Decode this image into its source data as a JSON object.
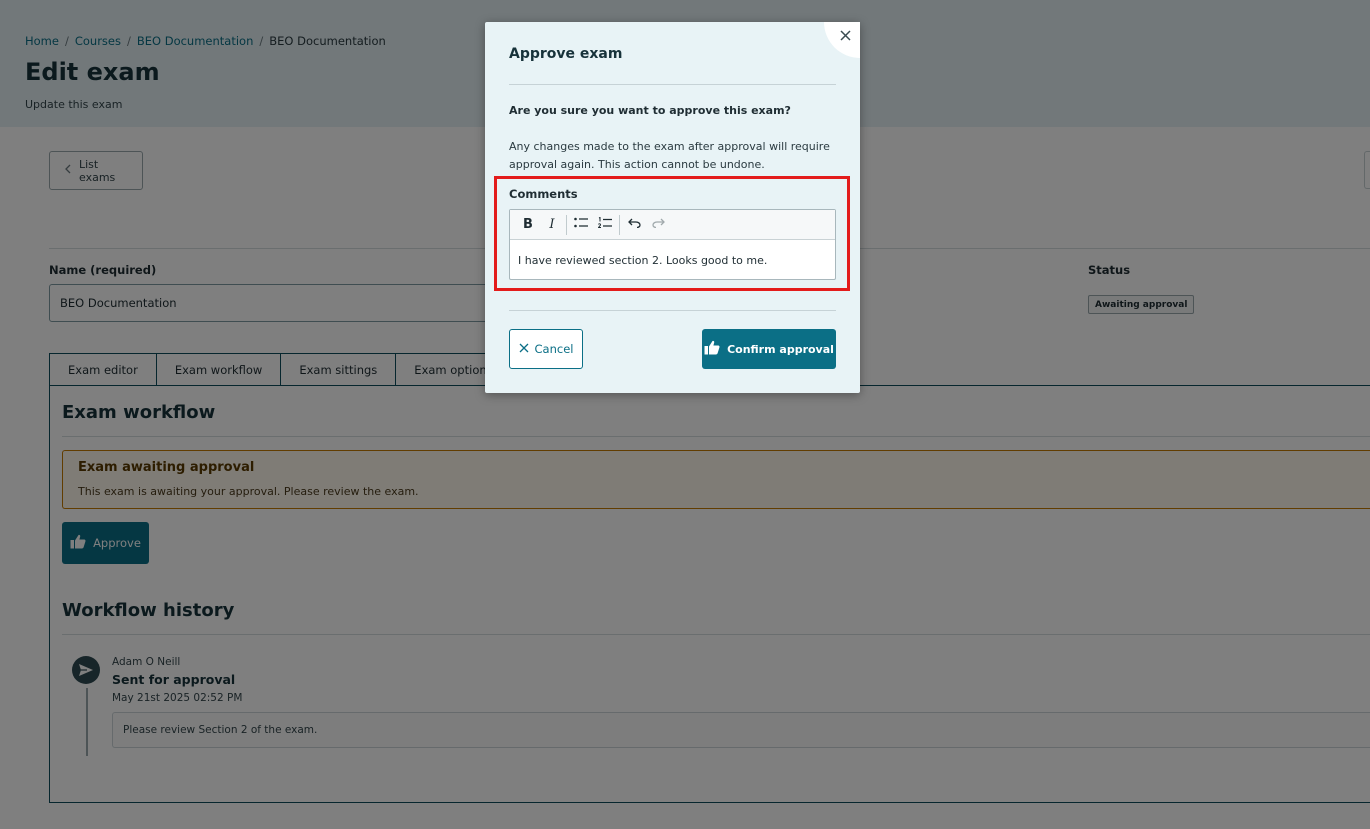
{
  "breadcrumb": {
    "items": [
      "Home",
      "Courses",
      "BEO Documentation",
      "BEO Documentation"
    ],
    "separator": "/"
  },
  "header": {
    "title": "Edit exam",
    "subtitle": "Update this exam"
  },
  "toolbar": {
    "list_exams_label": "List exams"
  },
  "form": {
    "name_label": "Name (required)",
    "name_value": "BEO Documentation",
    "status_label": "Status",
    "status_value": "Awaiting approval"
  },
  "tabs": [
    {
      "label": "Exam editor",
      "active": false
    },
    {
      "label": "Exam workflow",
      "active": true
    },
    {
      "label": "Exam sittings",
      "active": false
    },
    {
      "label": "Exam options",
      "active": false
    }
  ],
  "workflow": {
    "title": "Exam workflow",
    "alert_title": "Exam awaiting approval",
    "alert_text": "This exam is awaiting your approval. Please review the exam.",
    "approve_label": "Approve"
  },
  "history": {
    "title": "Workflow history",
    "items": [
      {
        "author": "Adam O Neill",
        "action": "Sent for approval",
        "date": "May 21st 2025 02:52 PM",
        "comment": "Please review Section 2 of the exam."
      }
    ]
  },
  "modal": {
    "title": "Approve exam",
    "question": "Are you sure you want to approve this exam?",
    "text": "Any changes made to the exam after approval will require approval again. This action cannot be undone.",
    "comments_label": "Comments",
    "comment_value": "I have reviewed section 2. Looks good to me.",
    "toolbar": {
      "bold": "B",
      "italic": "I"
    },
    "cancel_label": "Cancel",
    "confirm_label": "Confirm approval"
  },
  "colors": {
    "primary": "#0b6f86",
    "header_bg": "#e4f1f5",
    "modal_bg": "#e8f3f6",
    "highlight": "#e31b1b",
    "alert_border": "#c47b00"
  }
}
